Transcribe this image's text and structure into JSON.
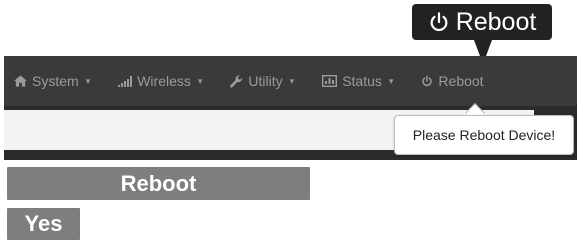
{
  "callout": {
    "label": "Reboot",
    "icon": "power-icon"
  },
  "navbar": {
    "items": [
      {
        "label": "System",
        "icon": "home-icon",
        "has_caret": true
      },
      {
        "label": "Wireless",
        "icon": "signal-bars-icon",
        "has_caret": true
      },
      {
        "label": "Utility",
        "icon": "wrench-icon",
        "has_caret": true
      },
      {
        "label": "Status",
        "icon": "bar-chart-icon",
        "has_caret": true
      },
      {
        "label": "Reboot",
        "icon": "power-icon",
        "has_caret": false
      }
    ],
    "caret": "▾"
  },
  "popover": {
    "text": "Please Reboot Device!"
  },
  "labels": {
    "reboot": "Reboot",
    "yes": "Yes"
  },
  "colors": {
    "navbar_bg": "#3a3a3a",
    "nav_text": "#9b9b9b",
    "callout_bg": "#222222",
    "label_bg": "#7e7e7e"
  }
}
